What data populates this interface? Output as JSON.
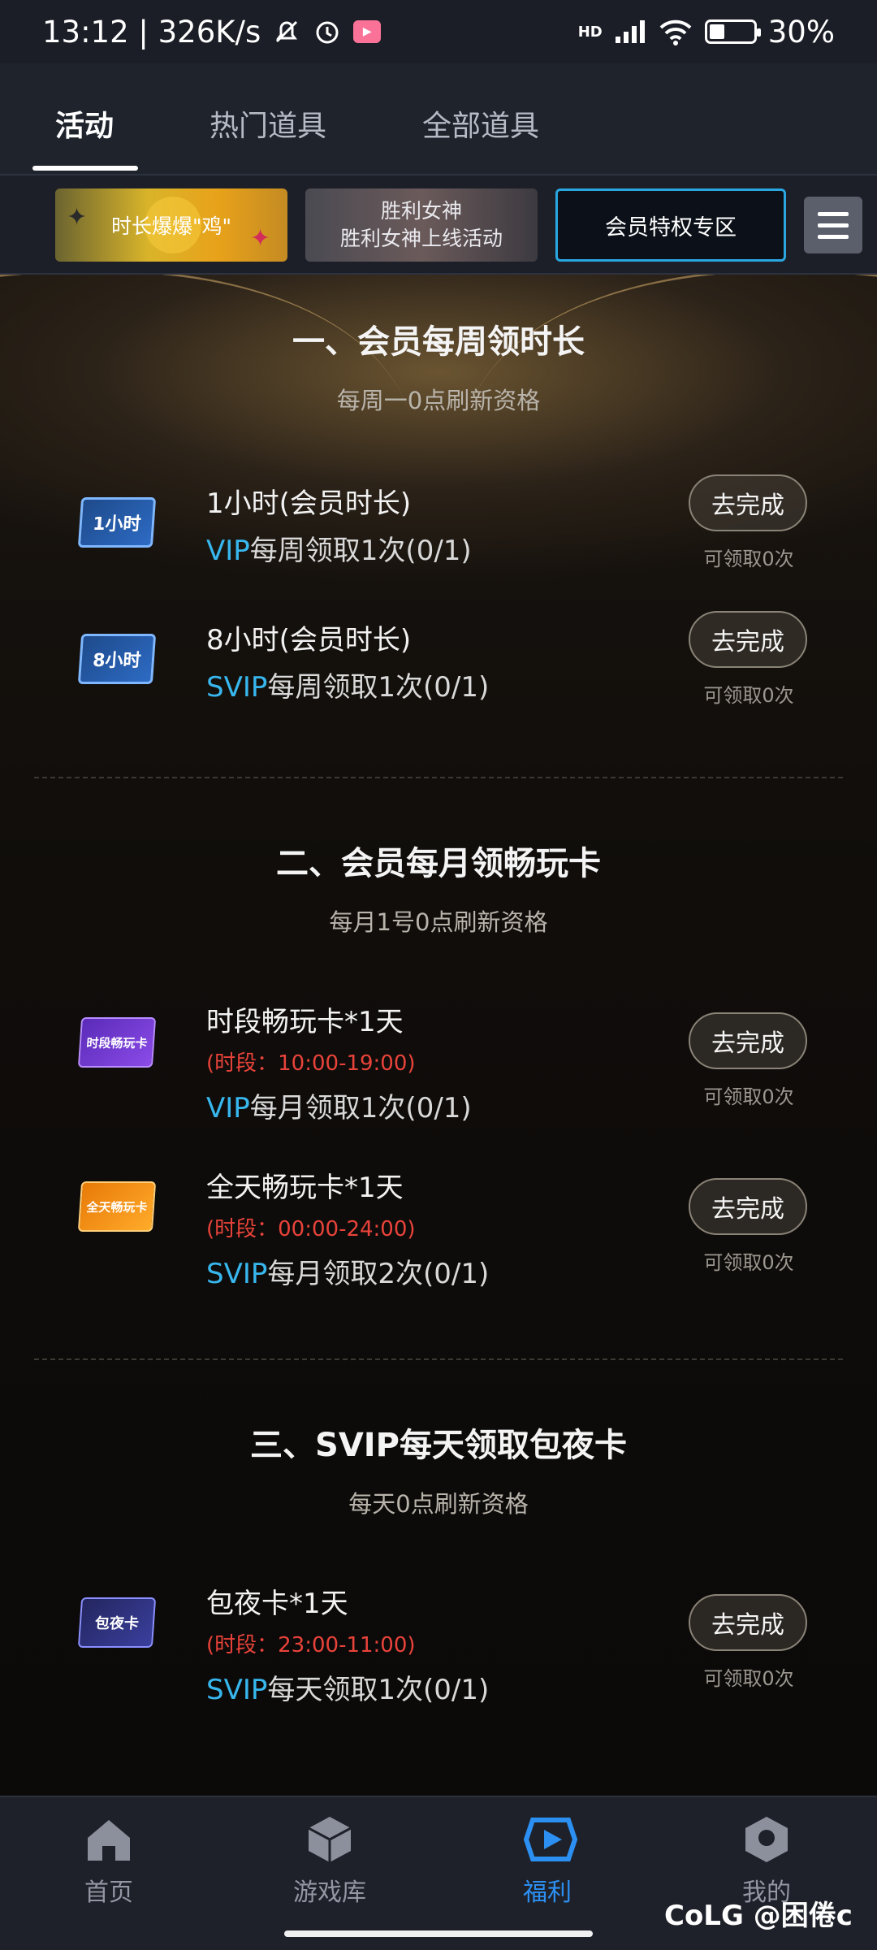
{
  "status_bar": {
    "time_speed": "13:12 | 326K/s",
    "network": "HD",
    "battery": "30%"
  },
  "tabs": [
    {
      "label": "活动",
      "active": true
    },
    {
      "label": "热门道具",
      "active": false
    },
    {
      "label": "全部道具",
      "active": false
    }
  ],
  "banners": [
    {
      "label": "时长爆爆\"鸡\""
    },
    {
      "line1": "胜利女神",
      "line2": "胜利女神上线活动"
    },
    {
      "label": "会员特权专区"
    }
  ],
  "sections": [
    {
      "title": "一、会员每周领时长",
      "subtitle": "每周一0点刷新资格",
      "items": [
        {
          "icon_text": "1小时",
          "title": "1小时(会员时长)",
          "tier": "VIP",
          "quota": "每周领取1次(0/1)",
          "button": "去完成",
          "count": "可领取0次"
        },
        {
          "icon_text": "8小时",
          "title": "8小时(会员时长)",
          "tier": "SVIP",
          "quota": "每周领取1次(0/1)",
          "button": "去完成",
          "count": "可领取0次"
        }
      ]
    },
    {
      "title": "二、会员每月领畅玩卡",
      "subtitle": "每月1号0点刷新资格",
      "items": [
        {
          "icon_text": "时段畅玩卡",
          "title": "时段畅玩卡*1天",
          "period": "(时段：10:00-19:00)",
          "tier": "VIP",
          "quota": "每月领取1次(0/1)",
          "button": "去完成",
          "count": "可领取0次"
        },
        {
          "icon_text": "全天畅玩卡",
          "title": "全天畅玩卡*1天",
          "period": "(时段：00:00-24:00)",
          "tier": "SVIP",
          "quota": "每月领取2次(0/1)",
          "button": "去完成",
          "count": "可领取0次"
        }
      ]
    },
    {
      "title": "三、SVIP每天领取包夜卡",
      "subtitle": "每天0点刷新资格",
      "items": [
        {
          "icon_text": "包夜卡",
          "title": "包夜卡*1天",
          "period": "(时段：23:00-11:00)",
          "tier": "SVIP",
          "quota": "每天领取1次(0/1)",
          "button": "去完成",
          "count": "可领取0次"
        }
      ]
    }
  ],
  "bottom_nav": [
    {
      "label": "首页",
      "icon": "home-icon",
      "active": false
    },
    {
      "label": "游戏库",
      "icon": "cube-icon",
      "active": false
    },
    {
      "label": "福利",
      "icon": "play-gift-icon",
      "active": true
    },
    {
      "label": "我的",
      "icon": "profile-icon",
      "active": false
    }
  ],
  "watermark": "CoLG @困倦c",
  "colors": {
    "accent_blue": "#2c8ff2",
    "tier_cyan": "#38b7ee",
    "period_red": "#e8433a"
  }
}
